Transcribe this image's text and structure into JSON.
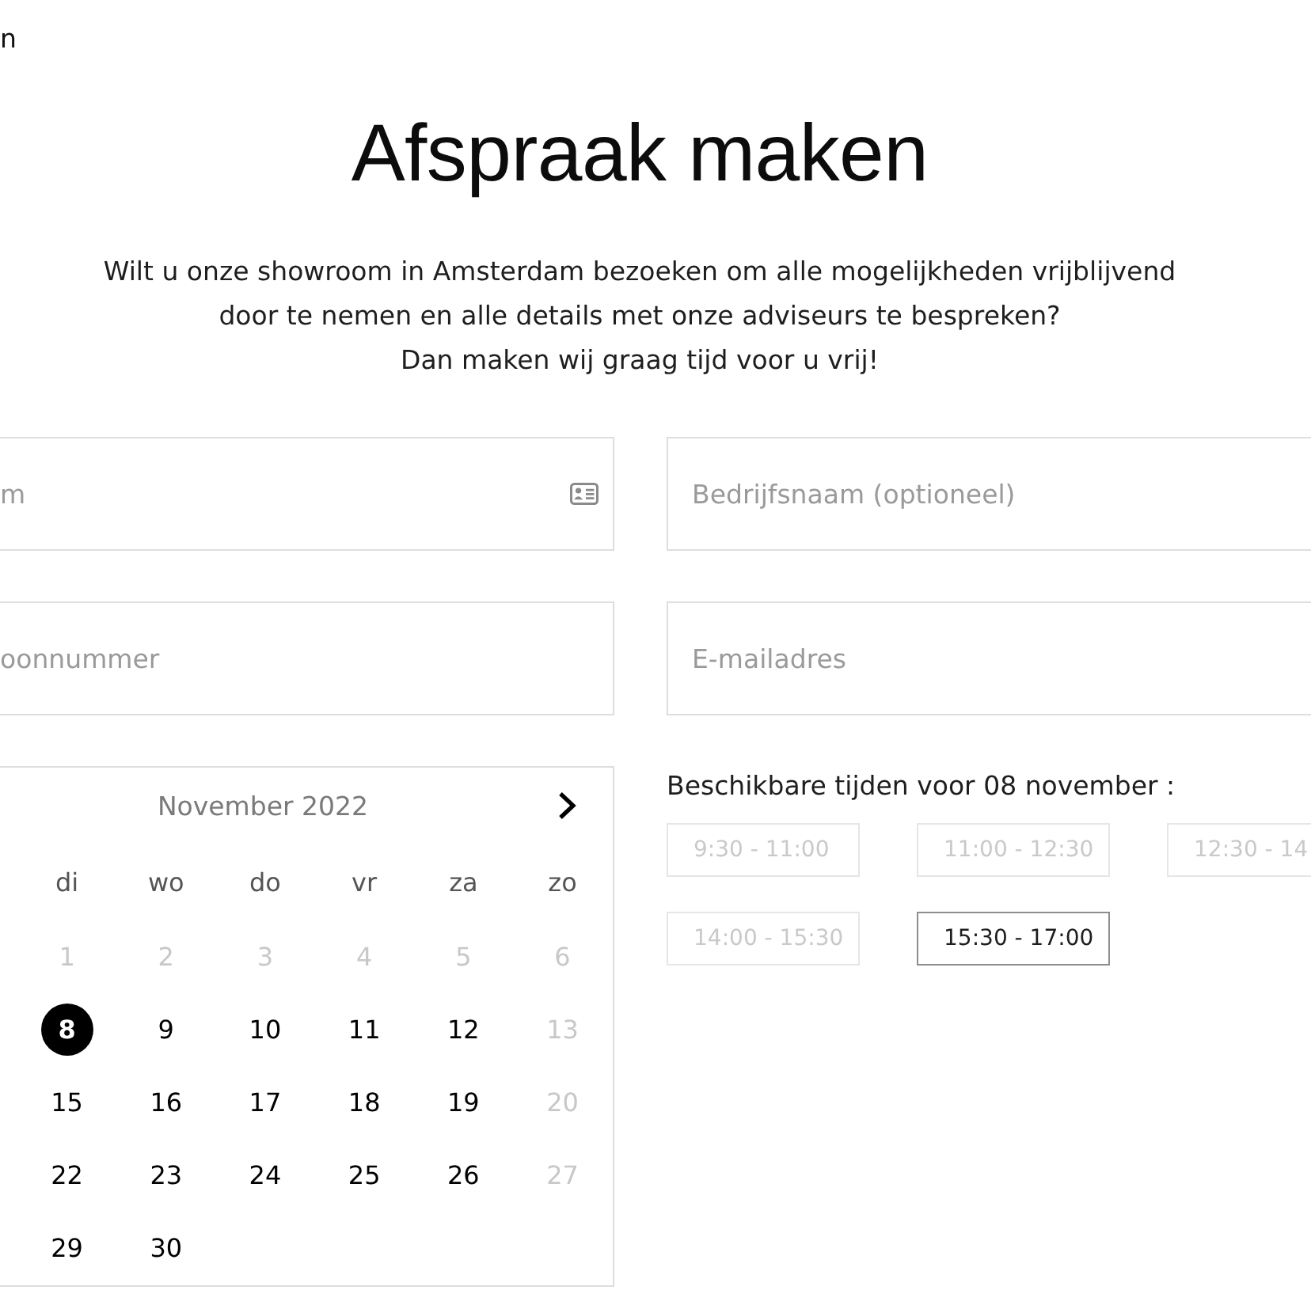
{
  "header": {
    "text_fragment": "n"
  },
  "title": "Afspraak maken",
  "intro_lines": [
    "Wilt u onze showroom in Amsterdam bezoeken om alle mogelijkheden vrijblijvend",
    "door te nemen en alle details met onze adviseurs te bespreken?",
    "Dan maken wij graag tijd voor u vrij!"
  ],
  "form": {
    "fields": [
      {
        "kind": "icon",
        "placeholder": "m"
      },
      {
        "kind": "plain",
        "placeholder": "Bedrijfsnaam (optioneel)"
      },
      {
        "kind": "plain",
        "placeholder": "oonnummer"
      },
      {
        "kind": "plain",
        "placeholder": "E-mailadres"
      }
    ]
  },
  "calendar": {
    "month": "November 2022",
    "weekdays": [
      "di",
      "wo",
      "do",
      "vr",
      "za",
      "zo"
    ],
    "weeks": [
      [
        {
          "day": "1",
          "disabled": true,
          "selected": false
        },
        {
          "day": "2",
          "disabled": true,
          "selected": false
        },
        {
          "day": "3",
          "disabled": true,
          "selected": false
        },
        {
          "day": "4",
          "disabled": true,
          "selected": false
        },
        {
          "day": "5",
          "disabled": true,
          "selected": false
        },
        {
          "day": "6",
          "disabled": true,
          "selected": false
        }
      ],
      [
        {
          "day": "8",
          "disabled": false,
          "selected": true
        },
        {
          "day": "9",
          "disabled": false,
          "selected": false
        },
        {
          "day": "10",
          "disabled": false,
          "selected": false
        },
        {
          "day": "11",
          "disabled": false,
          "selected": false
        },
        {
          "day": "12",
          "disabled": false,
          "selected": false
        },
        {
          "day": "13",
          "disabled": true,
          "selected": false
        }
      ],
      [
        {
          "day": "15",
          "disabled": false,
          "selected": false
        },
        {
          "day": "16",
          "disabled": false,
          "selected": false
        },
        {
          "day": "17",
          "disabled": false,
          "selected": false
        },
        {
          "day": "18",
          "disabled": false,
          "selected": false
        },
        {
          "day": "19",
          "disabled": false,
          "selected": false
        },
        {
          "day": "20",
          "disabled": true,
          "selected": false
        }
      ],
      [
        {
          "day": "22",
          "disabled": false,
          "selected": false
        },
        {
          "day": "23",
          "disabled": false,
          "selected": false
        },
        {
          "day": "24",
          "disabled": false,
          "selected": false
        },
        {
          "day": "25",
          "disabled": false,
          "selected": false
        },
        {
          "day": "26",
          "disabled": false,
          "selected": false
        },
        {
          "day": "27",
          "disabled": true,
          "selected": false
        }
      ],
      [
        {
          "day": "29",
          "disabled": false,
          "selected": false
        },
        {
          "day": "30",
          "disabled": false,
          "selected": false
        }
      ]
    ]
  },
  "times": {
    "label": "Beschikbare tijden voor 08 november :",
    "slots": [
      {
        "label": "9:30 - 11:00",
        "disabled": true
      },
      {
        "label": "11:00 - 12:30",
        "disabled": true
      },
      {
        "label": "12:30 - 14",
        "disabled": true
      },
      {
        "label": "14:00 - 15:30",
        "disabled": true
      },
      {
        "label": "15:30 - 17:00",
        "disabled": false
      }
    ]
  }
}
